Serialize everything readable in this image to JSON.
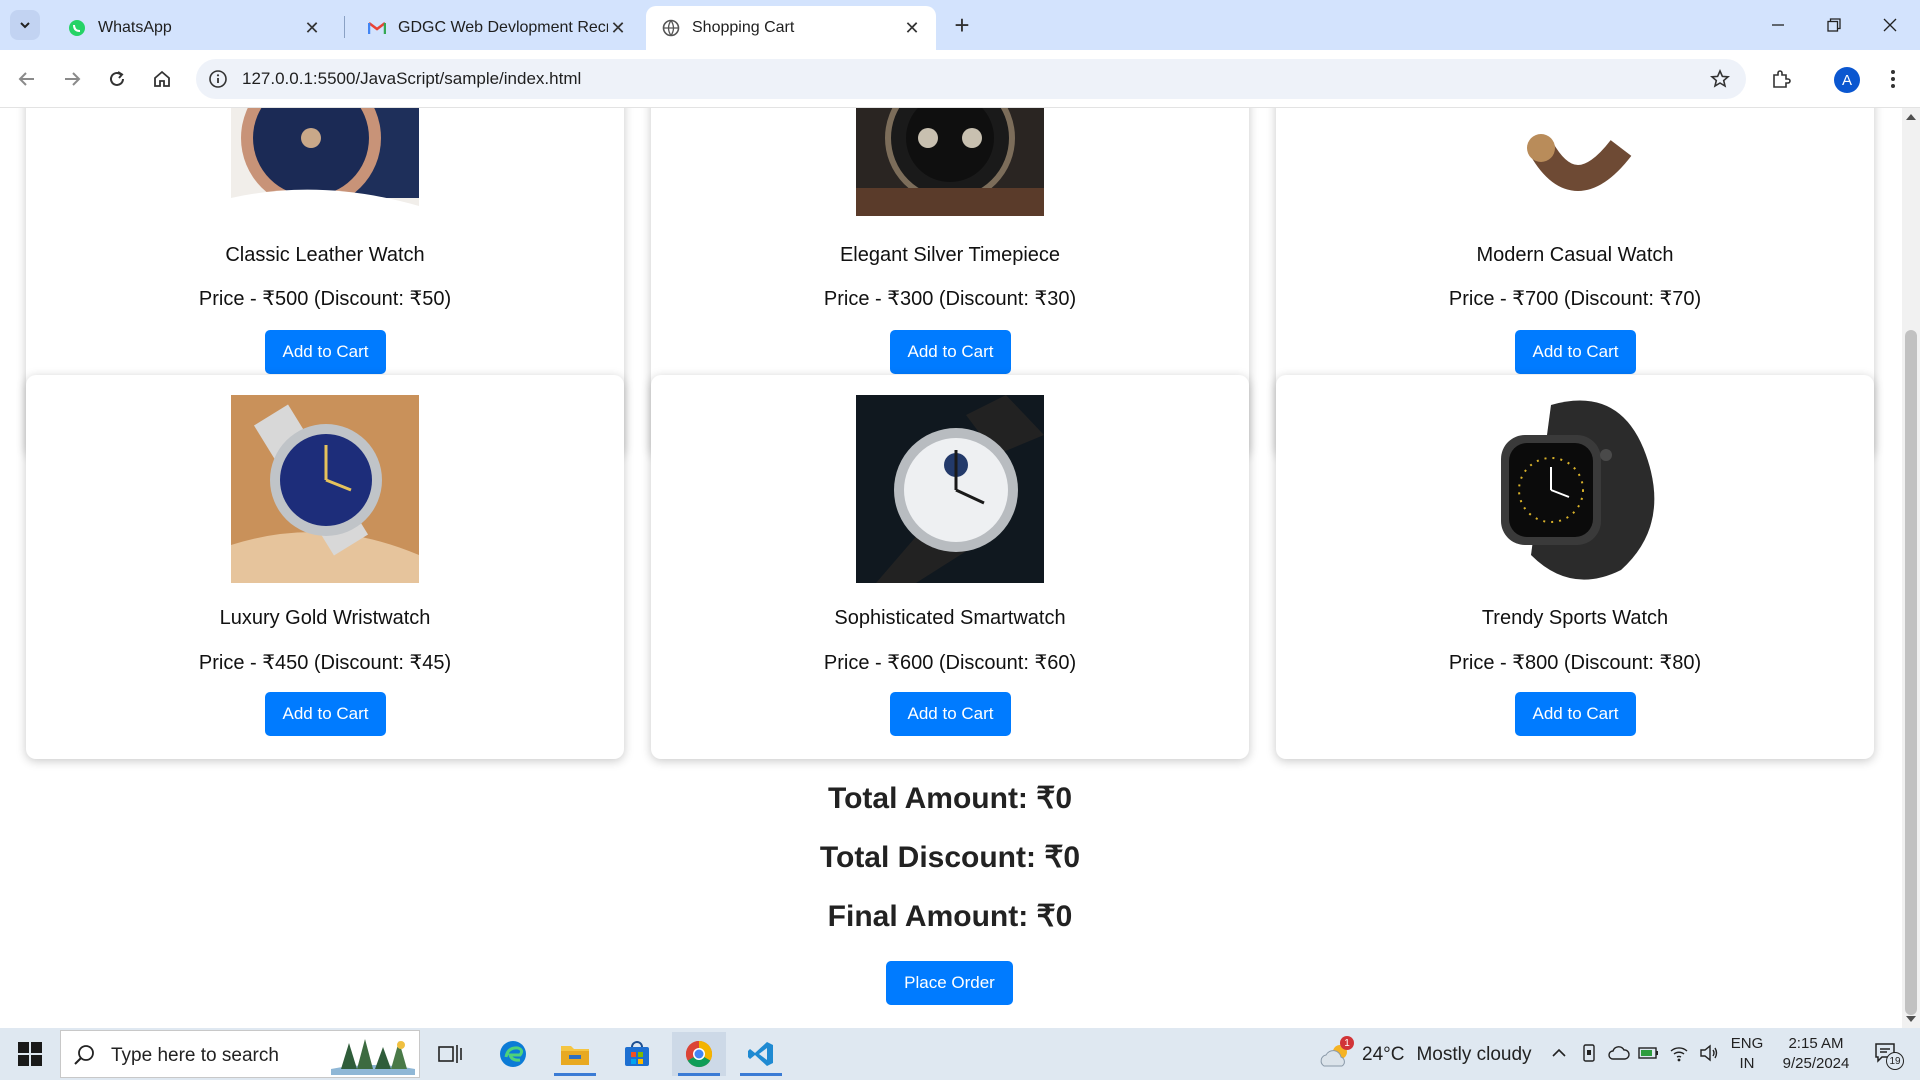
{
  "browser": {
    "tabs": [
      {
        "title": "WhatsApp",
        "icon": "whatsapp-icon",
        "active": false
      },
      {
        "title": "GDGC Web Devlopment Recruit",
        "icon": "gmail-icon",
        "active": false
      },
      {
        "title": "Shopping Cart",
        "icon": "globe-icon",
        "active": true
      }
    ],
    "url": "127.0.0.1:5500/JavaScript/sample/index.html",
    "profile_initial": "A"
  },
  "products": [
    {
      "name": "Classic Leather Watch",
      "price_text": "Price - ₹500 (Discount: ₹50)",
      "button": "Add to Cart"
    },
    {
      "name": "Elegant Silver Timepiece",
      "price_text": "Price - ₹300 (Discount: ₹30)",
      "button": "Add to Cart"
    },
    {
      "name": "Modern Casual Watch",
      "price_text": "Price - ₹700 (Discount: ₹70)",
      "button": "Add to Cart"
    },
    {
      "name": "Luxury Gold Wristwatch",
      "price_text": "Price - ₹450 (Discount: ₹45)",
      "button": "Add to Cart"
    },
    {
      "name": "Sophisticated Smartwatch",
      "price_text": "Price - ₹600 (Discount: ₹60)",
      "button": "Add to Cart"
    },
    {
      "name": "Trendy Sports Watch",
      "price_text": "Price - ₹800 (Discount: ₹80)",
      "button": "Add to Cart"
    }
  ],
  "summary": {
    "total": "Total Amount: ₹0",
    "discount": "Total Discount: ₹0",
    "final": "Final Amount: ₹0",
    "place_order": "Place Order"
  },
  "taskbar": {
    "search_placeholder": "Type here to search",
    "weather_temp": "24°C",
    "weather_desc": "Mostly cloudy",
    "weather_badge": "1",
    "lang_line1": "ENG",
    "lang_line2": "IN",
    "time": "2:15 AM",
    "date": "9/25/2024",
    "notification_count": "19"
  },
  "colors": {
    "accent": "#007bff",
    "tabstrip": "#d3e3fd",
    "taskbar": "#dfe8f1"
  }
}
